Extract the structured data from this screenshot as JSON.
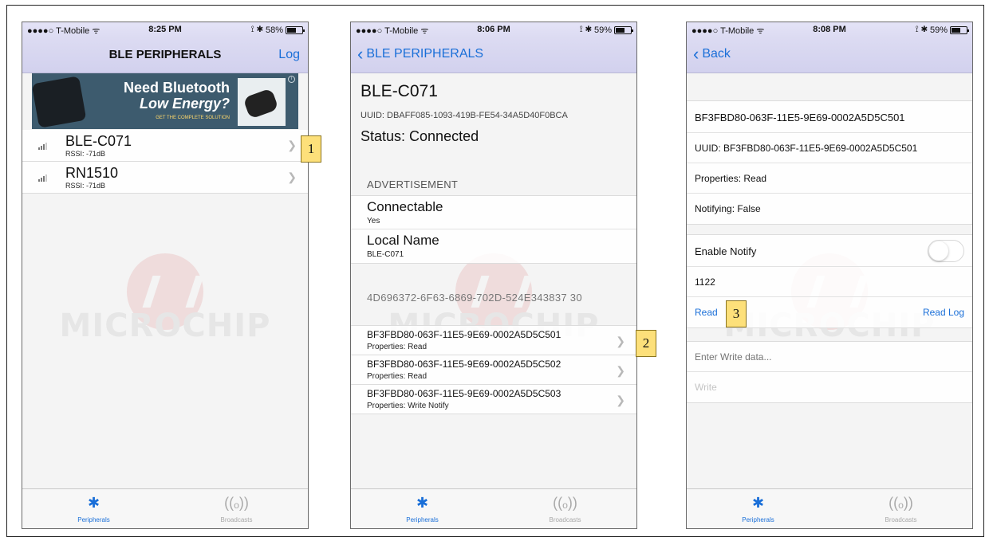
{
  "status_bar": {
    "screen1": {
      "carrier": "●●●●○ T-Mobile ᯤ",
      "time": "8:25 PM",
      "battery": "58%"
    },
    "screen2": {
      "carrier": "●●●●○ T-Mobile ᯤ",
      "time": "8:06 PM",
      "battery": "59%"
    },
    "screen3": {
      "carrier": "●●●●○ T-Mobile ᯤ",
      "time": "8:08 PM",
      "battery": "59%"
    },
    "indicators": "⟟ ✱"
  },
  "screen1": {
    "nav_title": "BLE PERIPHERALS",
    "nav_right": "Log",
    "banner": {
      "line1": "Need Bluetooth",
      "line2": "Low Energy?",
      "line3": "GET THE COMPLETE SOLUTION",
      "info": "i"
    },
    "peripherals": [
      {
        "name": "BLE-C071",
        "rssi": "RSSI: -71dB"
      },
      {
        "name": "RN1510",
        "rssi": "RSSI: -71dB"
      }
    ]
  },
  "screen2": {
    "back_label": "BLE PERIPHERALS",
    "title": "BLE-C071",
    "uuid": "UUID: DBAFF085-1093-419B-FE54-34A5D40F0BCA",
    "status": "Status: Connected",
    "advertisement_header": "ADVERTISEMENT",
    "advertisement": [
      {
        "key": "Connectable",
        "value": "Yes"
      },
      {
        "key": "Local Name",
        "value": "BLE-C071"
      }
    ],
    "service_uuid": "4D696372-6F63-6869-702D-524E343837 30",
    "characteristics": [
      {
        "uuid": "BF3FBD80-063F-11E5-9E69-0002A5D5C501",
        "props": "Properties: Read"
      },
      {
        "uuid": "BF3FBD80-063F-11E5-9E69-0002A5D5C502",
        "props": "Properties: Read"
      },
      {
        "uuid": "BF3FBD80-063F-11E5-9E69-0002A5D5C503",
        "props": "Properties: Write Notify"
      }
    ]
  },
  "screen3": {
    "back_label": "Back",
    "char_uuid": "BF3FBD80-063F-11E5-9E69-0002A5D5C501",
    "uuid": "UUID: BF3FBD80-063F-11E5-9E69-0002A5D5C501",
    "properties": "Properties: Read",
    "notifying": "Notifying: False",
    "enable_notify": "Enable Notify",
    "value": "1122",
    "read_label": "Read",
    "read_log_label": "Read Log",
    "write_placeholder": "Enter Write data...",
    "write_label": "Write"
  },
  "tabbar": {
    "peripherals": "Peripherals",
    "broadcasts": "Broadcasts",
    "bt_icon": "✱",
    "broadcast_icon": "((ₒ))"
  },
  "watermark": "MICROCHIP",
  "callouts": [
    "1",
    "2",
    "3"
  ],
  "colors": {
    "accent": "#1a6fd8",
    "nav_bg": "#d8d7f0",
    "callout": "#fde07a"
  }
}
